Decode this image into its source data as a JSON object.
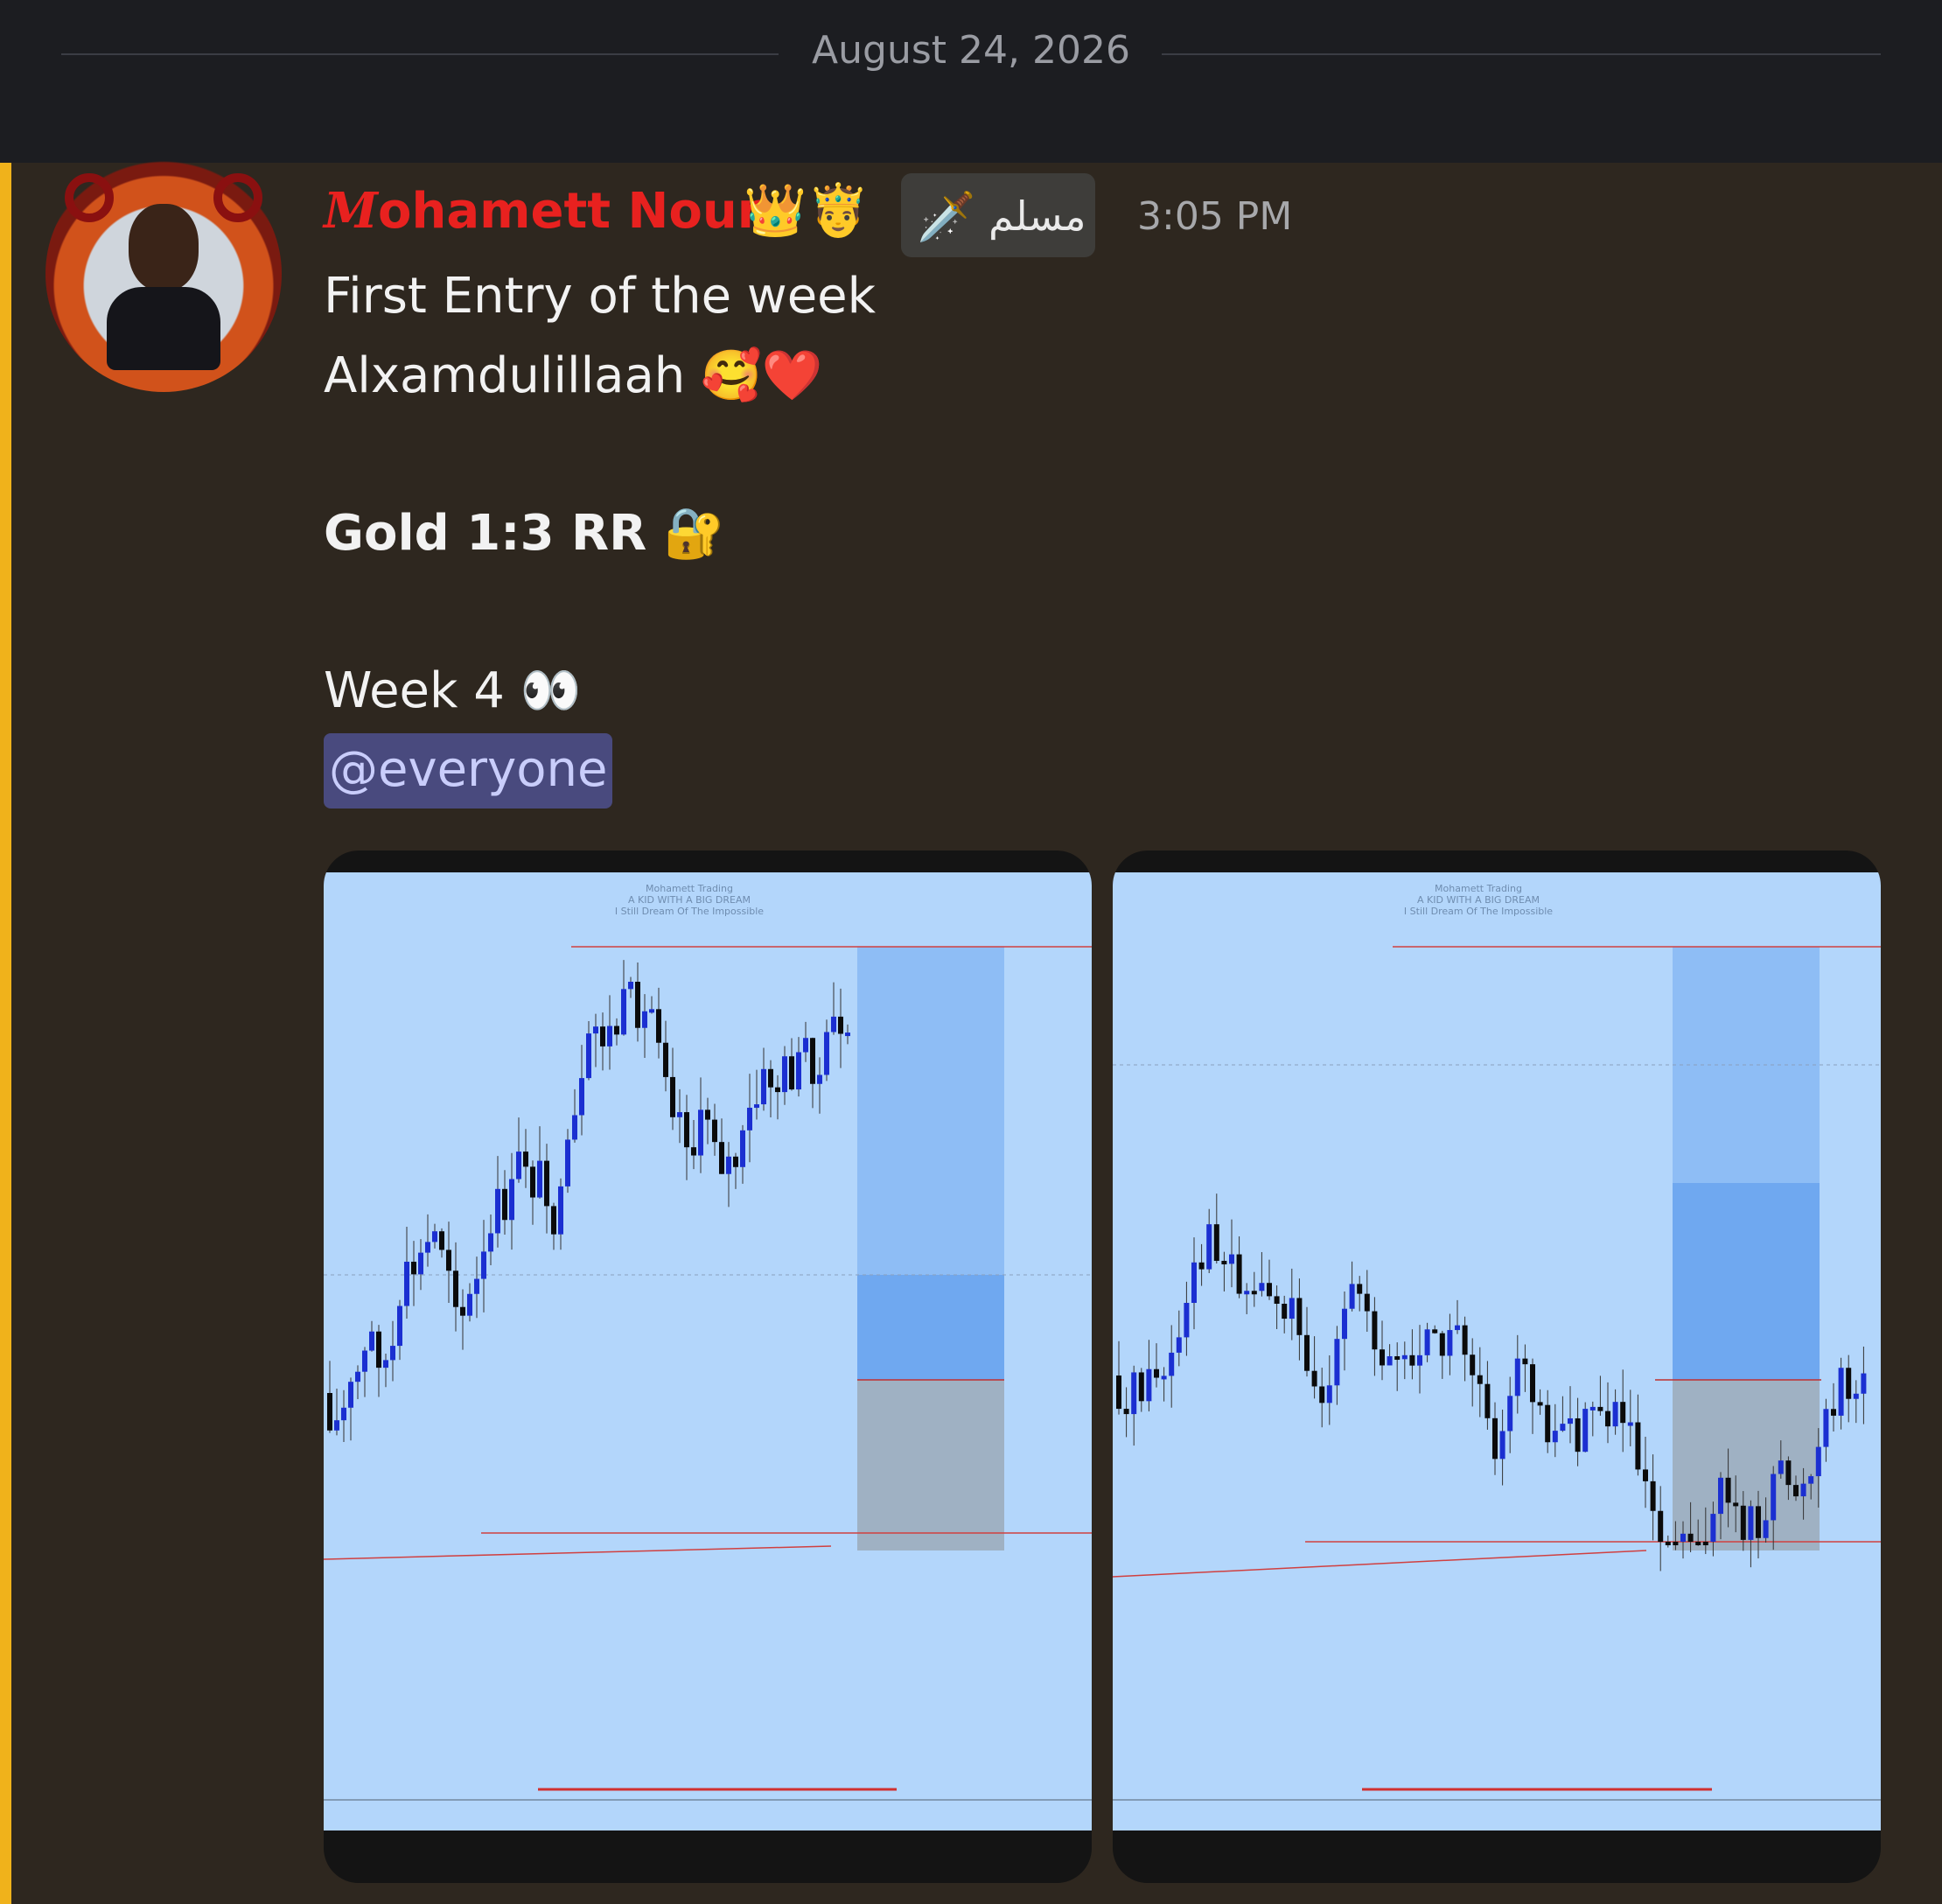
{
  "divider": {
    "date": "August 24, 2026"
  },
  "message": {
    "username_initial": "M",
    "username_rest": "ohamett Nour",
    "username_emoji": "👑🤴",
    "role_badge": {
      "icon": "🗡️",
      "text": "مسلم"
    },
    "timestamp": "3:05 PM",
    "lines": {
      "l1": "First Entry of the week",
      "l2": "Alxamdulillaah 🥰❤️",
      "l3": "Gold 1:3 RR 🔐",
      "l4": "Week 4 👀"
    },
    "mention": "@everyone",
    "attachments": [
      {
        "header_lines": [
          "Mohamett Trading",
          "A KID WITH A BIG DREAM",
          "I Still Dream Of The Impossible"
        ]
      },
      {
        "header_lines": [
          "Mohamett Trading",
          "A KID WITH A BIG DREAM",
          "I Still Dream Of The Impossible"
        ]
      }
    ]
  },
  "colors": {
    "accent_bar": "#f0b21b",
    "username": "#e8211f",
    "mention_bg": "#494a7e",
    "chart_bg": "#b3d6fb",
    "bull_candle": "#1b2fd1",
    "bear_candle": "#0b0b0b"
  }
}
